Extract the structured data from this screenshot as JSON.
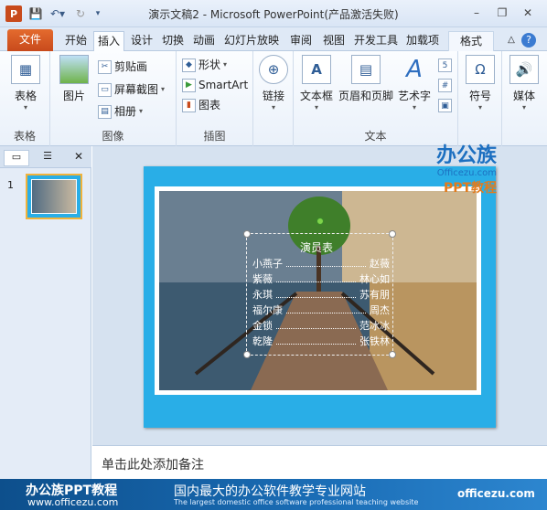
{
  "window": {
    "title": "演示文稿2 - Microsoft PowerPoint(产品激活失败)",
    "app_icon": "P"
  },
  "tabs": [
    "文件",
    "开始",
    "插入",
    "设计",
    "切换",
    "动画",
    "幻灯片放映",
    "审阅",
    "视图",
    "开发工具",
    "加载项",
    "格式"
  ],
  "active_tab": "插入",
  "ribbon": {
    "groups": {
      "tables": "表格",
      "images": "图像",
      "illustrations": "插图",
      "links": "链接",
      "text": "文本",
      "symbols": "符号",
      "media": "媒体"
    },
    "table_btn": "表格",
    "picture_btn": "图片",
    "clipart": "剪贴画",
    "screenshot": "屏幕截图",
    "album": "相册",
    "shapes": "形状",
    "smartart": "SmartArt",
    "chart": "图表",
    "link_btn": "链接",
    "textbox": "文本框",
    "header_footer": "页眉和页脚",
    "wordart": "艺术字",
    "symbol_btn": "符号",
    "media_btn": "媒体"
  },
  "panel": {
    "slide_number": "1"
  },
  "slide": {
    "heading": "演员表",
    "rows": [
      [
        "小燕子",
        "赵薇"
      ],
      [
        "紫薇",
        "林心如"
      ],
      [
        "永琪",
        "苏有朋"
      ],
      [
        "福尔康",
        "周杰"
      ],
      [
        "金锁",
        "范冰冰"
      ],
      [
        "乾隆",
        "张铁林"
      ]
    ]
  },
  "notes_placeholder": "单击此处添加备注",
  "watermark": {
    "brand": "办公族",
    "url": "Officezu.com",
    "ppt": "PPT教程"
  },
  "footer": {
    "left_title": "办公族PPT教程",
    "left_url": "www.officezu.com",
    "center": "国内最大的办公软件教学专业网站",
    "center_sub": "The largest domestic office software professional teaching website",
    "right": "officezu.com"
  }
}
